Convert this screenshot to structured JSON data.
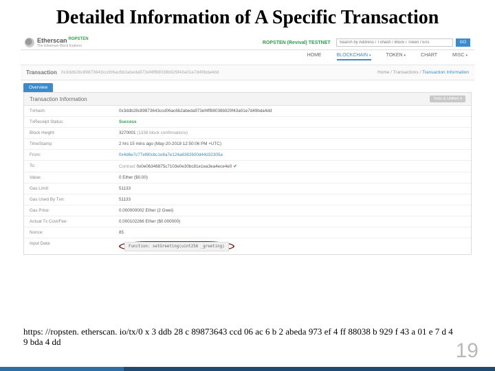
{
  "slide": {
    "title": "Detailed Information of A Specific Transaction",
    "number": "19",
    "footer_url": "https: //ropsten. etherscan. io/tx/0 x 3 ddb 28 c 89873643 ccd 06 ac 6 b 2 abeda 973 ef 4 ff 88038 b 929 f 43 a 01 e 7 d 49 bda 4 dd"
  },
  "topbar": {
    "logo_name": "Etherscan",
    "logo_tag": "The Ethereum Block Explorer",
    "logo_ropsten": "ROPSTEN",
    "testnet_label": "ROPSTEN (Revival) TESTNET",
    "search_placeholder": "Search by Address / Txhash / Block / Token / Ens",
    "go": "GO"
  },
  "nav": {
    "home": "HOME",
    "blockchain": "BLOCKCHAIN",
    "token": "TOKEN",
    "chart": "CHART",
    "misc": "MISC"
  },
  "txheader": {
    "label": "Transaction",
    "hash": "0x3ddb28c89873643ccd06ac6b2abeda973ef4ff88038b929f43a01e7d49bda4dd",
    "crumb_home": "Home",
    "crumb_txs": "Transactions",
    "crumb_current": "Transaction Information",
    "sep": " / "
  },
  "tabs": {
    "overview": "Overview"
  },
  "panel": {
    "title": "Transaction Information",
    "tools": "Tools & Utilities"
  },
  "rows": {
    "txhash_k": "TxHash:",
    "txhash_v": "0x3ddb28c89873643ccd06ac6b2abeda973ef4ff88038b929f43a01e7d49bda4dd",
    "receipt_k": "TxReceipt Status:",
    "receipt_v": "Success",
    "block_k": "Block Height:",
    "block_v": "3270001",
    "block_conf": " (1338 block confirmations)",
    "time_k": "TimeStamp:",
    "time_v": "2 hrs 15 mins ago (May-20-2018 12:50:06 PM +UTC)",
    "from_k": "From:",
    "from_v": "0x4d6e7c77ef80cbc1e8a7e124a8382600d44d32305a",
    "to_k": "To:",
    "to_prefix": "Contract ",
    "to_v": "0x0e06346875c7103e0e30bc81e1ea3ea4ece4e0",
    "value_k": "Value:",
    "value_v": "0 Ether ($0.00)",
    "gaslimit_k": "Gas Limit:",
    "gaslimit_v": "51133",
    "gasused_k": "Gas Used By Txn:",
    "gasused_v": "51133",
    "gasprice_k": "Gas Price:",
    "gasprice_v": "0.000000002 Ether (2 Gwei)",
    "cost_k": "Actual Tx Cost/Fee:",
    "cost_v": "0.000102266 Ether ($0.000000)",
    "nonce_k": "Nonce:",
    "nonce_v": "85",
    "input_k": "Input Data:",
    "input_v": "Function: setGreeting(uint256 _greeting)"
  }
}
